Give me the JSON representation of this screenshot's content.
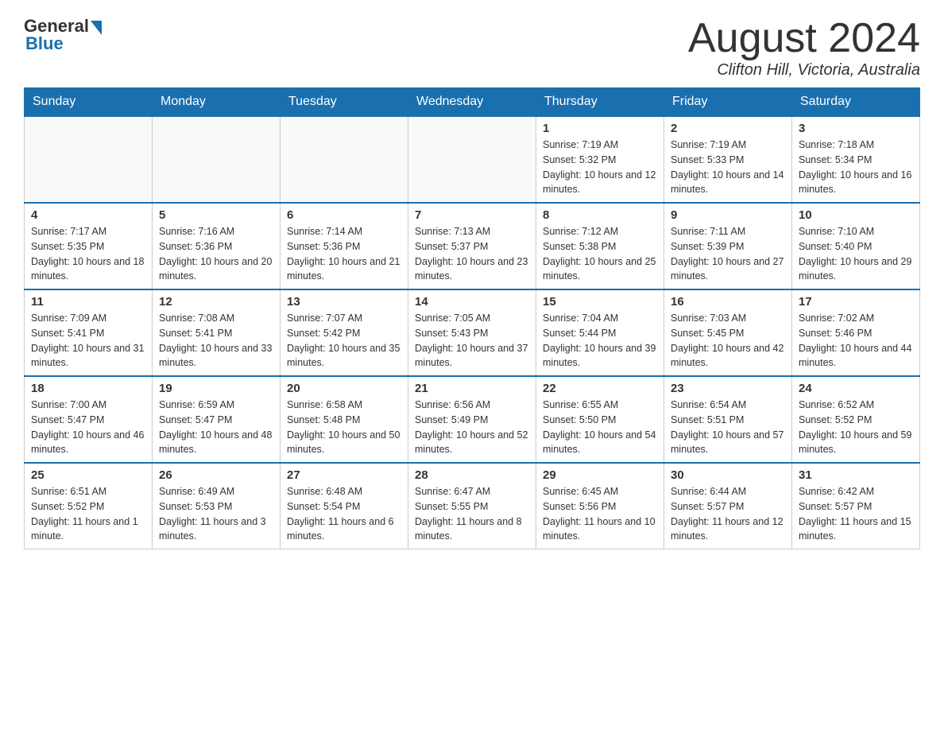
{
  "logo": {
    "general": "General",
    "blue": "Blue"
  },
  "title": "August 2024",
  "location": "Clifton Hill, Victoria, Australia",
  "weekdays": [
    "Sunday",
    "Monday",
    "Tuesday",
    "Wednesday",
    "Thursday",
    "Friday",
    "Saturday"
  ],
  "weeks": [
    [
      {
        "day": "",
        "info": ""
      },
      {
        "day": "",
        "info": ""
      },
      {
        "day": "",
        "info": ""
      },
      {
        "day": "",
        "info": ""
      },
      {
        "day": "1",
        "info": "Sunrise: 7:19 AM\nSunset: 5:32 PM\nDaylight: 10 hours and 12 minutes."
      },
      {
        "day": "2",
        "info": "Sunrise: 7:19 AM\nSunset: 5:33 PM\nDaylight: 10 hours and 14 minutes."
      },
      {
        "day": "3",
        "info": "Sunrise: 7:18 AM\nSunset: 5:34 PM\nDaylight: 10 hours and 16 minutes."
      }
    ],
    [
      {
        "day": "4",
        "info": "Sunrise: 7:17 AM\nSunset: 5:35 PM\nDaylight: 10 hours and 18 minutes."
      },
      {
        "day": "5",
        "info": "Sunrise: 7:16 AM\nSunset: 5:36 PM\nDaylight: 10 hours and 20 minutes."
      },
      {
        "day": "6",
        "info": "Sunrise: 7:14 AM\nSunset: 5:36 PM\nDaylight: 10 hours and 21 minutes."
      },
      {
        "day": "7",
        "info": "Sunrise: 7:13 AM\nSunset: 5:37 PM\nDaylight: 10 hours and 23 minutes."
      },
      {
        "day": "8",
        "info": "Sunrise: 7:12 AM\nSunset: 5:38 PM\nDaylight: 10 hours and 25 minutes."
      },
      {
        "day": "9",
        "info": "Sunrise: 7:11 AM\nSunset: 5:39 PM\nDaylight: 10 hours and 27 minutes."
      },
      {
        "day": "10",
        "info": "Sunrise: 7:10 AM\nSunset: 5:40 PM\nDaylight: 10 hours and 29 minutes."
      }
    ],
    [
      {
        "day": "11",
        "info": "Sunrise: 7:09 AM\nSunset: 5:41 PM\nDaylight: 10 hours and 31 minutes."
      },
      {
        "day": "12",
        "info": "Sunrise: 7:08 AM\nSunset: 5:41 PM\nDaylight: 10 hours and 33 minutes."
      },
      {
        "day": "13",
        "info": "Sunrise: 7:07 AM\nSunset: 5:42 PM\nDaylight: 10 hours and 35 minutes."
      },
      {
        "day": "14",
        "info": "Sunrise: 7:05 AM\nSunset: 5:43 PM\nDaylight: 10 hours and 37 minutes."
      },
      {
        "day": "15",
        "info": "Sunrise: 7:04 AM\nSunset: 5:44 PM\nDaylight: 10 hours and 39 minutes."
      },
      {
        "day": "16",
        "info": "Sunrise: 7:03 AM\nSunset: 5:45 PM\nDaylight: 10 hours and 42 minutes."
      },
      {
        "day": "17",
        "info": "Sunrise: 7:02 AM\nSunset: 5:46 PM\nDaylight: 10 hours and 44 minutes."
      }
    ],
    [
      {
        "day": "18",
        "info": "Sunrise: 7:00 AM\nSunset: 5:47 PM\nDaylight: 10 hours and 46 minutes."
      },
      {
        "day": "19",
        "info": "Sunrise: 6:59 AM\nSunset: 5:47 PM\nDaylight: 10 hours and 48 minutes."
      },
      {
        "day": "20",
        "info": "Sunrise: 6:58 AM\nSunset: 5:48 PM\nDaylight: 10 hours and 50 minutes."
      },
      {
        "day": "21",
        "info": "Sunrise: 6:56 AM\nSunset: 5:49 PM\nDaylight: 10 hours and 52 minutes."
      },
      {
        "day": "22",
        "info": "Sunrise: 6:55 AM\nSunset: 5:50 PM\nDaylight: 10 hours and 54 minutes."
      },
      {
        "day": "23",
        "info": "Sunrise: 6:54 AM\nSunset: 5:51 PM\nDaylight: 10 hours and 57 minutes."
      },
      {
        "day": "24",
        "info": "Sunrise: 6:52 AM\nSunset: 5:52 PM\nDaylight: 10 hours and 59 minutes."
      }
    ],
    [
      {
        "day": "25",
        "info": "Sunrise: 6:51 AM\nSunset: 5:52 PM\nDaylight: 11 hours and 1 minute."
      },
      {
        "day": "26",
        "info": "Sunrise: 6:49 AM\nSunset: 5:53 PM\nDaylight: 11 hours and 3 minutes."
      },
      {
        "day": "27",
        "info": "Sunrise: 6:48 AM\nSunset: 5:54 PM\nDaylight: 11 hours and 6 minutes."
      },
      {
        "day": "28",
        "info": "Sunrise: 6:47 AM\nSunset: 5:55 PM\nDaylight: 11 hours and 8 minutes."
      },
      {
        "day": "29",
        "info": "Sunrise: 6:45 AM\nSunset: 5:56 PM\nDaylight: 11 hours and 10 minutes."
      },
      {
        "day": "30",
        "info": "Sunrise: 6:44 AM\nSunset: 5:57 PM\nDaylight: 11 hours and 12 minutes."
      },
      {
        "day": "31",
        "info": "Sunrise: 6:42 AM\nSunset: 5:57 PM\nDaylight: 11 hours and 15 minutes."
      }
    ]
  ]
}
